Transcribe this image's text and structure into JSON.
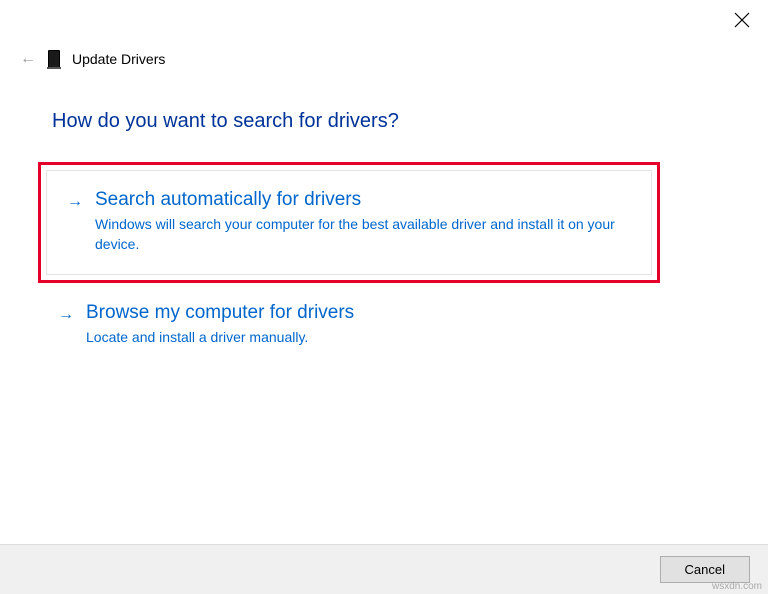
{
  "header": {
    "title": "Update Drivers"
  },
  "question": "How do you want to search for drivers?",
  "options": {
    "auto": {
      "title": "Search automatically for drivers",
      "desc": "Windows will search your computer for the best available driver and install it on your device."
    },
    "browse": {
      "title": "Browse my computer for drivers",
      "desc": "Locate and install a driver manually."
    }
  },
  "footer": {
    "cancel": "Cancel"
  },
  "watermark": "wsxdn.com"
}
